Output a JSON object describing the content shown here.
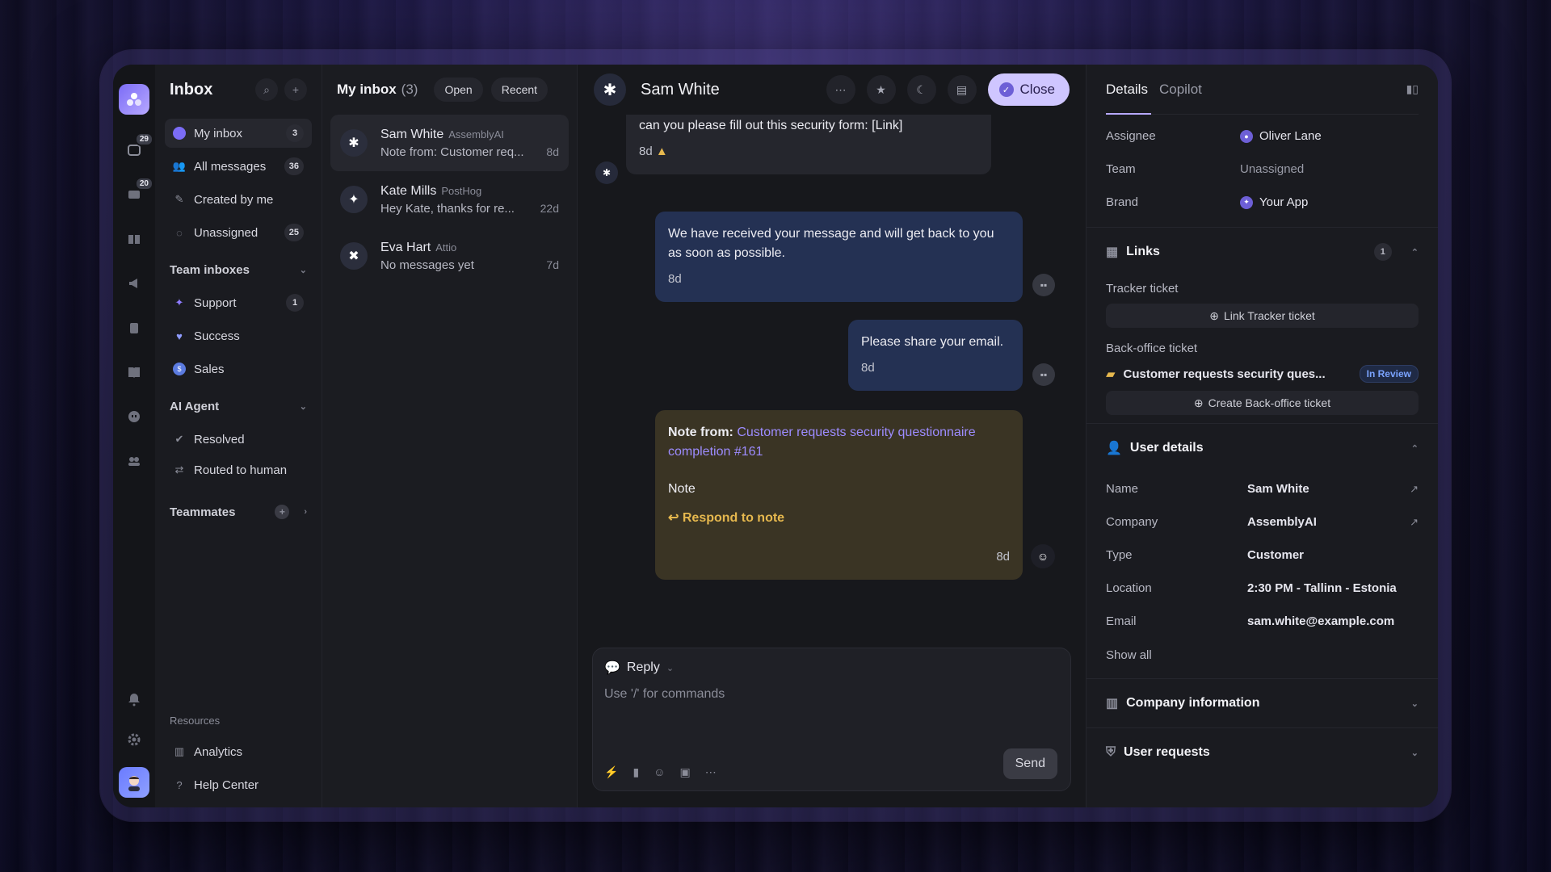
{
  "rail": {
    "badges": [
      "29",
      "20"
    ],
    "icons": [
      "inbox-icon",
      "messages-icon",
      "book-icon",
      "megaphone-icon",
      "clipboard-icon",
      "library-icon",
      "bot-icon",
      "people-icon",
      "bell-icon",
      "gear-icon"
    ]
  },
  "sidebar": {
    "title": "Inbox",
    "items": [
      {
        "label": "My inbox",
        "count": "3"
      },
      {
        "label": "All messages",
        "count": "36"
      },
      {
        "label": "Created by me",
        "count": ""
      },
      {
        "label": "Unassigned",
        "count": "25"
      }
    ],
    "team_inboxes": {
      "label": "Team inboxes",
      "items": [
        {
          "label": "Support",
          "count": "1"
        },
        {
          "label": "Success",
          "count": ""
        },
        {
          "label": "Sales",
          "count": ""
        }
      ]
    },
    "ai_agent": {
      "label": "AI Agent",
      "items": [
        {
          "label": "Resolved"
        },
        {
          "label": "Routed to human"
        }
      ]
    },
    "teammates": {
      "label": "Teammates"
    },
    "resources": {
      "label": "Resources",
      "items": [
        {
          "label": "Analytics"
        },
        {
          "label": "Help Center"
        }
      ]
    }
  },
  "convlist": {
    "title": "My inbox",
    "count": "(3)",
    "filters": [
      "Open",
      "Recent"
    ],
    "items": [
      {
        "name": "Sam White",
        "company": "AssemblyAI",
        "preview": "Note from: Customer req...",
        "time": "8d"
      },
      {
        "name": "Kate Mills",
        "company": "PostHog",
        "preview": "Hey Kate, thanks for re...",
        "time": "22d"
      },
      {
        "name": "Eva Hart",
        "company": "Attio",
        "preview": "No messages yet",
        "time": "7d"
      }
    ]
  },
  "chat": {
    "name": "Sam White",
    "close_label": "Close",
    "messages": [
      {
        "text": "can you please fill out this security form: [Link]",
        "time": "8d"
      },
      {
        "text": "We have received your message and will get back to you as soon as possible.",
        "time": "8d"
      },
      {
        "text": "Please share your email.",
        "time": "8d"
      }
    ],
    "note": {
      "prefix": "Note from:",
      "link": "Customer requests security questionnaire completion #161",
      "body": "Note",
      "action": "Respond to note",
      "time": "8d"
    },
    "composer": {
      "mode": "Reply",
      "placeholder": "Use '/' for commands",
      "send_label": "Send"
    }
  },
  "details": {
    "tabs": [
      "Details",
      "Copilot"
    ],
    "fields": [
      {
        "key": "Assignee",
        "value": "Oliver Lane"
      },
      {
        "key": "Team",
        "value": "Unassigned"
      },
      {
        "key": "Brand",
        "value": "Your App"
      }
    ],
    "links": {
      "title": "Links",
      "count": "1",
      "tracker_label": "Tracker ticket",
      "tracker_button": "Link Tracker ticket",
      "backoffice_label": "Back-office ticket",
      "backoffice_ticket": "Customer requests security ques...",
      "backoffice_status": "In Review",
      "backoffice_button": "Create Back-office ticket"
    },
    "user_details": {
      "title": "User details",
      "fields": [
        {
          "key": "Name",
          "value": "Sam White"
        },
        {
          "key": "Company",
          "value": "AssemblyAI"
        },
        {
          "key": "Type",
          "value": "Customer"
        },
        {
          "key": "Location",
          "value": "2:30 PM - Tallinn - Estonia"
        },
        {
          "key": "Email",
          "value": "sam.white@example.com"
        }
      ],
      "show_all": "Show all"
    },
    "company_information": {
      "title": "Company information"
    },
    "user_requests": {
      "title": "User requests"
    }
  },
  "colors": {
    "accent": "#b7a8ff",
    "note_bg": "#3a3424",
    "outgoing_bg": "#243153",
    "respond": "#e6b84e",
    "in_review": "#7aa3ff"
  }
}
